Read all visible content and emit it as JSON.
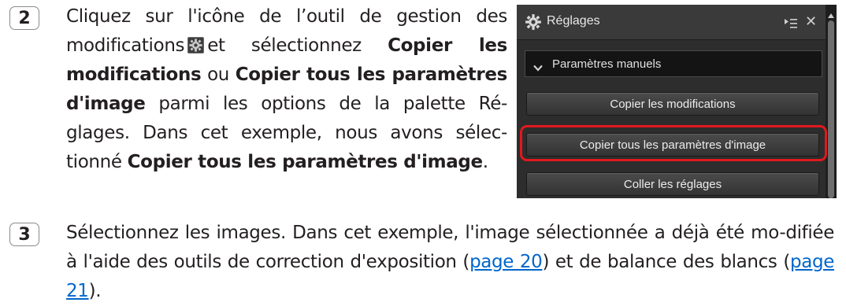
{
  "step2": {
    "number": "2",
    "text_before_icon": "Cliquez sur l'icône de l’outil de gestion des modifications",
    "text_after_icon": "et sélectionnez",
    "bold1": "Copier les modifications",
    "or": "ou",
    "bold2": "Copier tous les paramètres d'image",
    "text_middle": "parmi les options de la palette Ré-glages. Dans cet exemple, nous avons sélec-tionné",
    "bold3": "Copier tous les paramètres d'image",
    "end": "."
  },
  "step3": {
    "number": "3",
    "text1": "Sélectionnez les images. Dans cet exemple, l'image sélectionnée a déjà été mo-difiée à l'aide des outils de correction d'exposition (",
    "link1": "page 20",
    "text2": ") et de balance des blancs (",
    "link2": "page 21",
    "text3": ")."
  },
  "palette": {
    "title": "Réglages",
    "dropdown_label": "Paramètres manuels",
    "buttons": {
      "copy_modifications": "Copier les modifications",
      "copy_all_parameters": "Copier tous les paramètres d'image",
      "paste_settings": "Coller les réglages"
    },
    "icons": {
      "title_icon": "gear-icon",
      "menu_icon": "panel-menu-icon",
      "close_icon": "close-icon",
      "dropdown_icon": "chevron-down-icon"
    }
  },
  "colors": {
    "highlight": "#e0191f",
    "link": "#0066cc",
    "palette_bg": "#2d2d2d"
  }
}
